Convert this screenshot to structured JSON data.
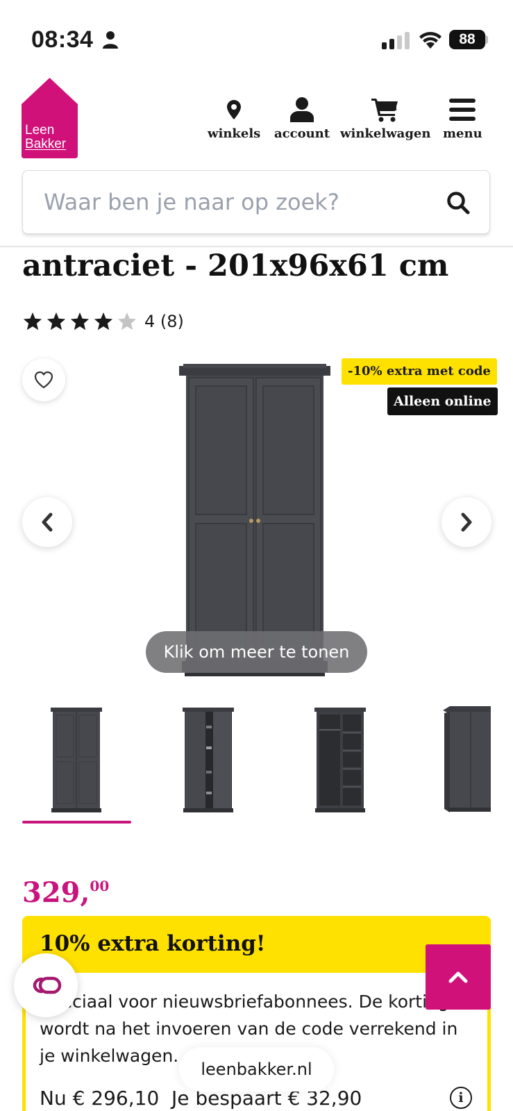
{
  "status_bar": {
    "time": "08:34",
    "battery": "88"
  },
  "header": {
    "logo": {
      "line1": "Leen",
      "line2": "Bakker"
    },
    "nav": [
      {
        "label": "winkels",
        "icon": "map-pin-icon"
      },
      {
        "label": "account",
        "icon": "user-icon"
      },
      {
        "label": "winkelwagen",
        "icon": "shopping-cart-icon"
      },
      {
        "label": "menu",
        "icon": "hamburger-menu-icon"
      }
    ]
  },
  "search": {
    "placeholder": "Waar ben je naar op zoek?",
    "value": ""
  },
  "product": {
    "title_fragment": "antraciet - 201x96x61 cm",
    "rating": {
      "stars": 4,
      "max": 5,
      "text": "4 (8)"
    },
    "badges": {
      "promo": "-10% extra met code",
      "online": "Alleen online"
    },
    "image_hint": "Klik om meer te tonen",
    "thumbnails_count": 4,
    "selected_thumbnail": 0,
    "price": {
      "whole": "329,",
      "cents": "00"
    }
  },
  "promo_box": {
    "title": "10% extra korting!",
    "text": "Speciaal voor nieuwsbriefabonnees. De korting wordt na het invoeren van de code verrekend in je winkelwagen.",
    "now_label": "Nu € 296,10",
    "save_label": "Je bespaart € 32,90"
  },
  "browser": {
    "url": "leenbakker.nl"
  },
  "colors": {
    "brand_magenta": "#c8157e",
    "promo_yellow": "#ffe100",
    "product_grey": "#3f4146"
  }
}
